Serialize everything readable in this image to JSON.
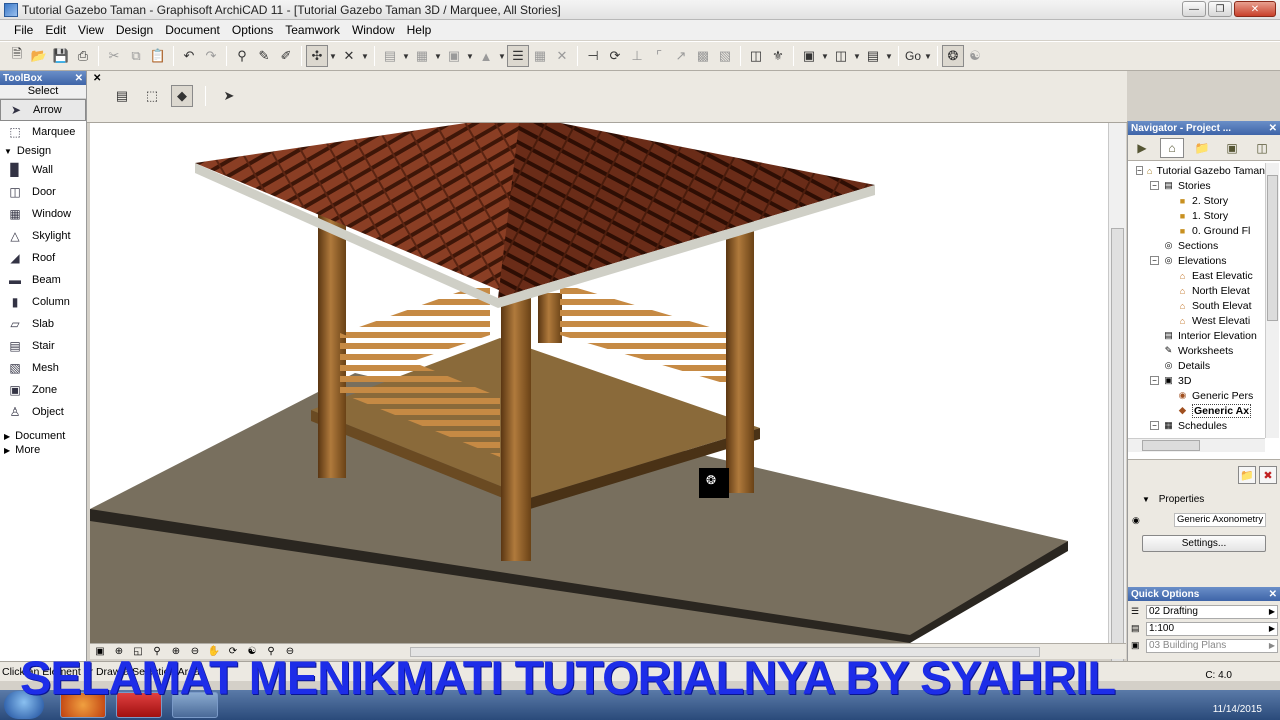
{
  "window": {
    "title": "Tutorial Gazebo Taman - Graphisoft ArchiCAD 11 - [Tutorial Gazebo Taman 3D / Marquee, All Stories]"
  },
  "menu": [
    "File",
    "Edit",
    "View",
    "Design",
    "Document",
    "Options",
    "Teamwork",
    "Window",
    "Help"
  ],
  "toolbar": {
    "go_label": "Go"
  },
  "toolbox": {
    "title": "ToolBox",
    "select_label": "Select",
    "select_tools": [
      "Arrow",
      "Marquee"
    ],
    "design_label": "Design",
    "design_tools": [
      "Wall",
      "Door",
      "Window",
      "Skylight",
      "Roof",
      "Beam",
      "Column",
      "Slab",
      "Stair",
      "Mesh",
      "Zone",
      "Object"
    ],
    "document_label": "Document",
    "more_label": "More"
  },
  "navigator": {
    "title": "Navigator - Project ...",
    "tree": [
      {
        "label": "Tutorial Gazebo Taman",
        "level": 0
      },
      {
        "label": "Stories",
        "level": 1
      },
      {
        "label": "2. Story",
        "level": 2
      },
      {
        "label": "1. Story",
        "level": 2
      },
      {
        "label": "0. Ground Fl",
        "level": 2
      },
      {
        "label": "Sections",
        "level": 1
      },
      {
        "label": "Elevations",
        "level": 1
      },
      {
        "label": "East Elevatic",
        "level": 2
      },
      {
        "label": "North Elevat",
        "level": 2
      },
      {
        "label": "South Elevat",
        "level": 2
      },
      {
        "label": "West Elevati",
        "level": 2
      },
      {
        "label": "Interior Elevation",
        "level": 1
      },
      {
        "label": "Worksheets",
        "level": 1
      },
      {
        "label": "Details",
        "level": 1
      },
      {
        "label": "3D",
        "level": 1
      },
      {
        "label": "Generic Pers",
        "level": 2
      },
      {
        "label": "Generic Ax",
        "level": 2
      },
      {
        "label": "Schedules",
        "level": 1
      }
    ],
    "properties_label": "Properties",
    "property_value": "Generic Axonometry",
    "settings_label": "Settings..."
  },
  "quick_options": {
    "title": "Quick Options",
    "items": [
      "02 Drafting",
      "1:100",
      "03 Building Plans"
    ]
  },
  "status_bar": {
    "text": "Click an Element or Draw a Selection Area",
    "right": "C: 4.0"
  },
  "taskbar": {
    "clock": "11/14/2015"
  },
  "overlay_caption": "SELAMAT MENIKMATI TUTORIALNYA BY SYAHRIL",
  "colors": {
    "caption": "#1d2de8",
    "roof": "#6e2e1c",
    "wood": "#a86a30",
    "ground": "#77705f"
  }
}
